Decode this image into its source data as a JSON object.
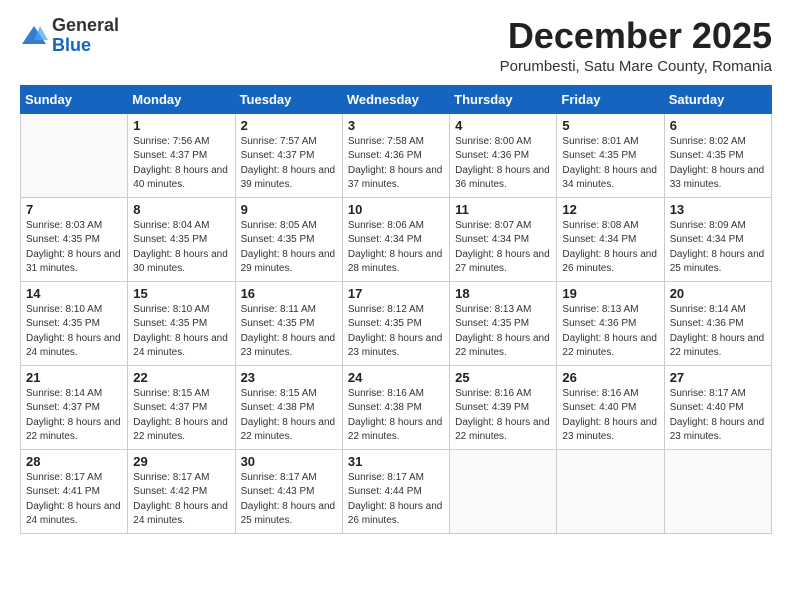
{
  "logo": {
    "general": "General",
    "blue": "Blue"
  },
  "title": {
    "month_year": "December 2025",
    "location": "Porumbesti, Satu Mare County, Romania"
  },
  "weekdays": [
    "Sunday",
    "Monday",
    "Tuesday",
    "Wednesday",
    "Thursday",
    "Friday",
    "Saturday"
  ],
  "weeks": [
    [
      {
        "day": "",
        "sunrise": "",
        "sunset": "",
        "daylight": ""
      },
      {
        "day": "1",
        "sunrise": "Sunrise: 7:56 AM",
        "sunset": "Sunset: 4:37 PM",
        "daylight": "Daylight: 8 hours and 40 minutes."
      },
      {
        "day": "2",
        "sunrise": "Sunrise: 7:57 AM",
        "sunset": "Sunset: 4:37 PM",
        "daylight": "Daylight: 8 hours and 39 minutes."
      },
      {
        "day": "3",
        "sunrise": "Sunrise: 7:58 AM",
        "sunset": "Sunset: 4:36 PM",
        "daylight": "Daylight: 8 hours and 37 minutes."
      },
      {
        "day": "4",
        "sunrise": "Sunrise: 8:00 AM",
        "sunset": "Sunset: 4:36 PM",
        "daylight": "Daylight: 8 hours and 36 minutes."
      },
      {
        "day": "5",
        "sunrise": "Sunrise: 8:01 AM",
        "sunset": "Sunset: 4:35 PM",
        "daylight": "Daylight: 8 hours and 34 minutes."
      },
      {
        "day": "6",
        "sunrise": "Sunrise: 8:02 AM",
        "sunset": "Sunset: 4:35 PM",
        "daylight": "Daylight: 8 hours and 33 minutes."
      }
    ],
    [
      {
        "day": "7",
        "sunrise": "Sunrise: 8:03 AM",
        "sunset": "Sunset: 4:35 PM",
        "daylight": "Daylight: 8 hours and 31 minutes."
      },
      {
        "day": "8",
        "sunrise": "Sunrise: 8:04 AM",
        "sunset": "Sunset: 4:35 PM",
        "daylight": "Daylight: 8 hours and 30 minutes."
      },
      {
        "day": "9",
        "sunrise": "Sunrise: 8:05 AM",
        "sunset": "Sunset: 4:35 PM",
        "daylight": "Daylight: 8 hours and 29 minutes."
      },
      {
        "day": "10",
        "sunrise": "Sunrise: 8:06 AM",
        "sunset": "Sunset: 4:34 PM",
        "daylight": "Daylight: 8 hours and 28 minutes."
      },
      {
        "day": "11",
        "sunrise": "Sunrise: 8:07 AM",
        "sunset": "Sunset: 4:34 PM",
        "daylight": "Daylight: 8 hours and 27 minutes."
      },
      {
        "day": "12",
        "sunrise": "Sunrise: 8:08 AM",
        "sunset": "Sunset: 4:34 PM",
        "daylight": "Daylight: 8 hours and 26 minutes."
      },
      {
        "day": "13",
        "sunrise": "Sunrise: 8:09 AM",
        "sunset": "Sunset: 4:34 PM",
        "daylight": "Daylight: 8 hours and 25 minutes."
      }
    ],
    [
      {
        "day": "14",
        "sunrise": "Sunrise: 8:10 AM",
        "sunset": "Sunset: 4:35 PM",
        "daylight": "Daylight: 8 hours and 24 minutes."
      },
      {
        "day": "15",
        "sunrise": "Sunrise: 8:10 AM",
        "sunset": "Sunset: 4:35 PM",
        "daylight": "Daylight: 8 hours and 24 minutes."
      },
      {
        "day": "16",
        "sunrise": "Sunrise: 8:11 AM",
        "sunset": "Sunset: 4:35 PM",
        "daylight": "Daylight: 8 hours and 23 minutes."
      },
      {
        "day": "17",
        "sunrise": "Sunrise: 8:12 AM",
        "sunset": "Sunset: 4:35 PM",
        "daylight": "Daylight: 8 hours and 23 minutes."
      },
      {
        "day": "18",
        "sunrise": "Sunrise: 8:13 AM",
        "sunset": "Sunset: 4:35 PM",
        "daylight": "Daylight: 8 hours and 22 minutes."
      },
      {
        "day": "19",
        "sunrise": "Sunrise: 8:13 AM",
        "sunset": "Sunset: 4:36 PM",
        "daylight": "Daylight: 8 hours and 22 minutes."
      },
      {
        "day": "20",
        "sunrise": "Sunrise: 8:14 AM",
        "sunset": "Sunset: 4:36 PM",
        "daylight": "Daylight: 8 hours and 22 minutes."
      }
    ],
    [
      {
        "day": "21",
        "sunrise": "Sunrise: 8:14 AM",
        "sunset": "Sunset: 4:37 PM",
        "daylight": "Daylight: 8 hours and 22 minutes."
      },
      {
        "day": "22",
        "sunrise": "Sunrise: 8:15 AM",
        "sunset": "Sunset: 4:37 PM",
        "daylight": "Daylight: 8 hours and 22 minutes."
      },
      {
        "day": "23",
        "sunrise": "Sunrise: 8:15 AM",
        "sunset": "Sunset: 4:38 PM",
        "daylight": "Daylight: 8 hours and 22 minutes."
      },
      {
        "day": "24",
        "sunrise": "Sunrise: 8:16 AM",
        "sunset": "Sunset: 4:38 PM",
        "daylight": "Daylight: 8 hours and 22 minutes."
      },
      {
        "day": "25",
        "sunrise": "Sunrise: 8:16 AM",
        "sunset": "Sunset: 4:39 PM",
        "daylight": "Daylight: 8 hours and 22 minutes."
      },
      {
        "day": "26",
        "sunrise": "Sunrise: 8:16 AM",
        "sunset": "Sunset: 4:40 PM",
        "daylight": "Daylight: 8 hours and 23 minutes."
      },
      {
        "day": "27",
        "sunrise": "Sunrise: 8:17 AM",
        "sunset": "Sunset: 4:40 PM",
        "daylight": "Daylight: 8 hours and 23 minutes."
      }
    ],
    [
      {
        "day": "28",
        "sunrise": "Sunrise: 8:17 AM",
        "sunset": "Sunset: 4:41 PM",
        "daylight": "Daylight: 8 hours and 24 minutes."
      },
      {
        "day": "29",
        "sunrise": "Sunrise: 8:17 AM",
        "sunset": "Sunset: 4:42 PM",
        "daylight": "Daylight: 8 hours and 24 minutes."
      },
      {
        "day": "30",
        "sunrise": "Sunrise: 8:17 AM",
        "sunset": "Sunset: 4:43 PM",
        "daylight": "Daylight: 8 hours and 25 minutes."
      },
      {
        "day": "31",
        "sunrise": "Sunrise: 8:17 AM",
        "sunset": "Sunset: 4:44 PM",
        "daylight": "Daylight: 8 hours and 26 minutes."
      },
      {
        "day": "",
        "sunrise": "",
        "sunset": "",
        "daylight": ""
      },
      {
        "day": "",
        "sunrise": "",
        "sunset": "",
        "daylight": ""
      },
      {
        "day": "",
        "sunrise": "",
        "sunset": "",
        "daylight": ""
      }
    ]
  ]
}
